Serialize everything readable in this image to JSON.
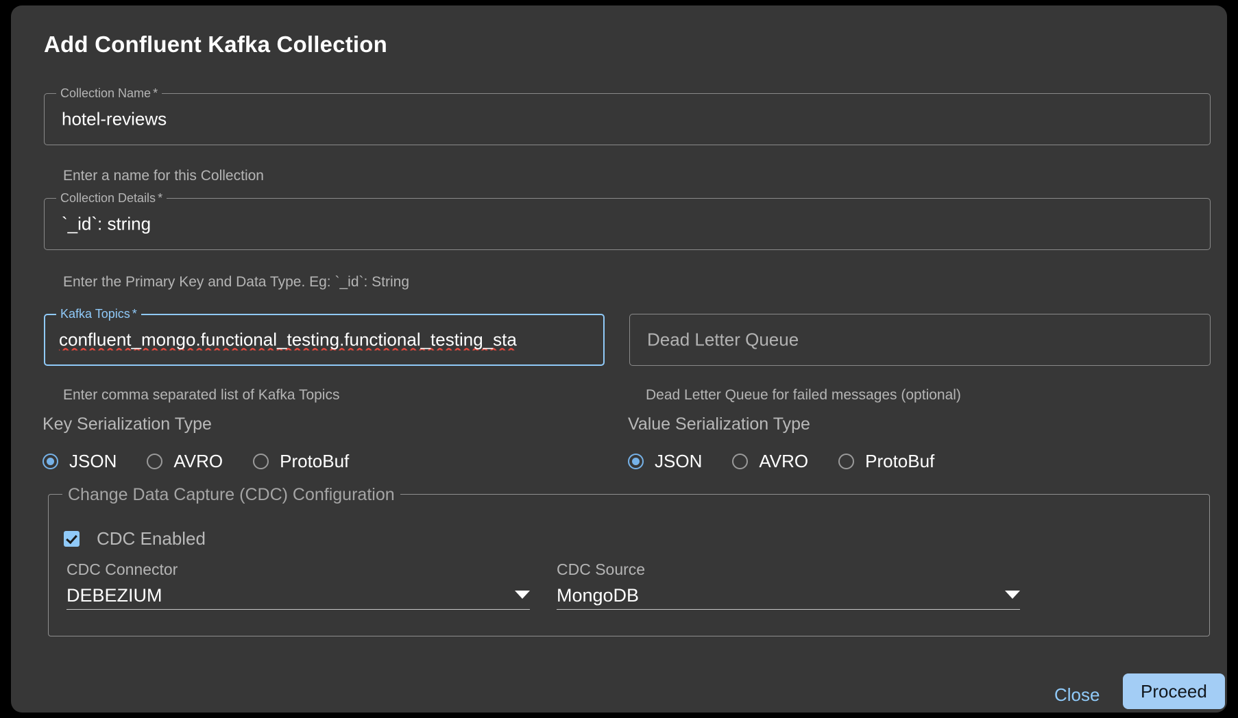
{
  "dialog": {
    "title": "Add Confluent Kafka Collection"
  },
  "fields": {
    "collection_name": {
      "label": "Collection Name",
      "required_mark": "*",
      "value": "hotel-reviews",
      "helper": "Enter a name for this Collection"
    },
    "collection_details": {
      "label": "Collection Details",
      "required_mark": "*",
      "value": "`_id`: string",
      "helper": "Enter the Primary Key and Data Type. Eg: `_id`: String"
    },
    "kafka_topics": {
      "label": "Kafka Topics",
      "required_mark": "*",
      "value": "confluent_mongo.functional_testing.functional_testing_sta",
      "helper": "Enter comma separated list of Kafka Topics"
    },
    "dead_letter_queue": {
      "label": "",
      "placeholder": "Dead Letter Queue",
      "value": "Dead Letter Queue",
      "helper": "Dead Letter Queue for failed messages (optional)"
    }
  },
  "key_serialization": {
    "heading": "Key Serialization Type",
    "options": [
      {
        "label": "JSON",
        "selected": true
      },
      {
        "label": "AVRO",
        "selected": false
      },
      {
        "label": "ProtoBuf",
        "selected": false
      }
    ]
  },
  "value_serialization": {
    "heading": "Value Serialization Type",
    "options": [
      {
        "label": "JSON",
        "selected": true
      },
      {
        "label": "AVRO",
        "selected": false
      },
      {
        "label": "ProtoBuf",
        "selected": false
      }
    ]
  },
  "cdc": {
    "legend": "Change Data Capture (CDC) Configuration",
    "enabled_label": "CDC Enabled",
    "enabled_checked": true,
    "connector": {
      "label": "CDC Connector",
      "value": "DEBEZIUM"
    },
    "source": {
      "label": "CDC Source",
      "value": "MongoDB"
    }
  },
  "footer": {
    "close_label": "Close",
    "proceed_label": "Proceed"
  },
  "colors": {
    "dialog_bg": "#373737",
    "accent": "#90caf9",
    "proceed_bg": "#a3cdf5",
    "spellcheck_underline": "#e04a3f"
  }
}
